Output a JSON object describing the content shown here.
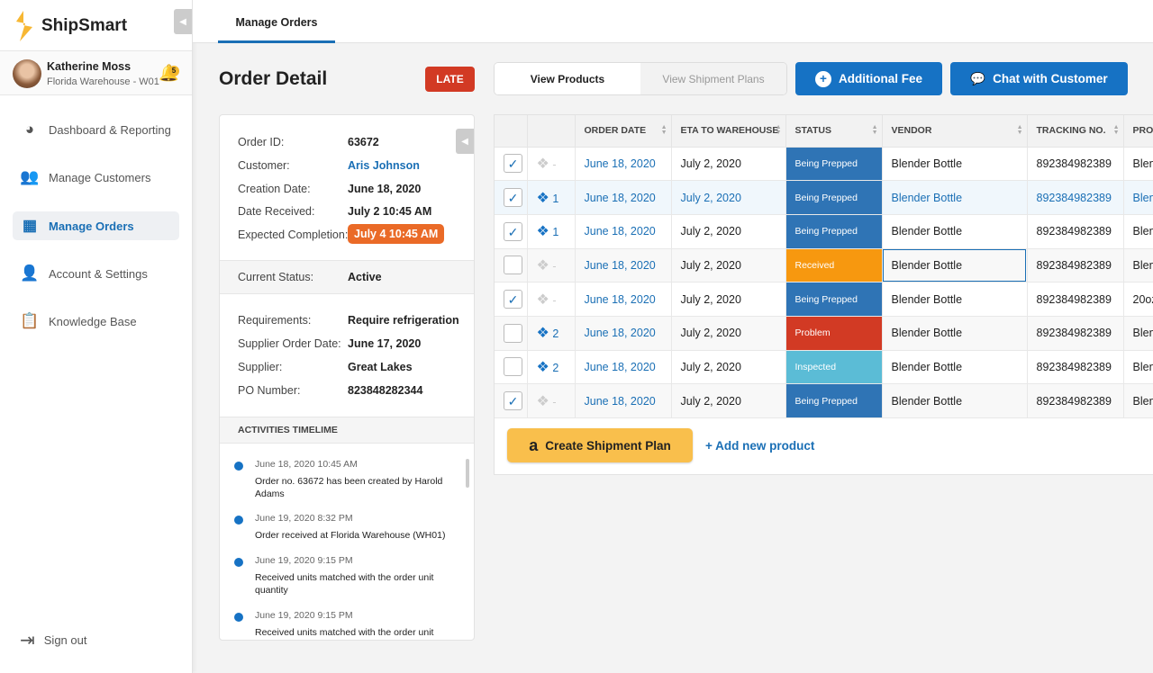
{
  "app": {
    "name": "ShipSmart"
  },
  "user": {
    "name": "Katherine Moss",
    "location": "Florida Warehouse - W01",
    "notifications": "5"
  },
  "nav": [
    {
      "label": "Dashboard & Reporting",
      "icon": "pie-chart-icon"
    },
    {
      "label": "Manage Customers",
      "icon": "users-icon"
    },
    {
      "label": "Manage Orders",
      "icon": "orders-grid-icon",
      "active": true
    },
    {
      "label": "Account & Settings",
      "icon": "user-icon"
    },
    {
      "label": "Knowledge Base",
      "icon": "clipboard-help-icon"
    }
  ],
  "signout": "Sign out",
  "topbar": {
    "tab": "Manage Orders"
  },
  "page": {
    "title": "Order Detail",
    "late": "LATE"
  },
  "views": {
    "products": "View Products",
    "plans": "View Shipment Plans"
  },
  "buttons": {
    "fee": "Additional Fee",
    "chat": "Chat with Customer",
    "plan": "Create Shipment Plan",
    "add": "+ Add new product"
  },
  "order": {
    "fields": [
      {
        "label": "Order ID:",
        "value": "63672"
      },
      {
        "label": "Customer:",
        "value": "Aris Johnson"
      },
      {
        "label": "Creation Date:",
        "value": "June 18, 2020"
      },
      {
        "label": "Date Received:",
        "value": "July 2 10:45 AM"
      },
      {
        "label": "Expected Completion:",
        "value": "July 4 10:45 AM"
      }
    ],
    "status": {
      "label": "Current Status:",
      "value": "Active"
    },
    "details": [
      {
        "label": "Requirements:",
        "value": "Require refrigeration"
      },
      {
        "label": "Supplier Order Date:",
        "value": "June 17, 2020"
      },
      {
        "label": "Supplier:",
        "value": "Great Lakes"
      },
      {
        "label": "PO Number:",
        "value": "823848282344"
      }
    ]
  },
  "timeline": {
    "title": "ACTIVITIES TIMELIME",
    "items": [
      {
        "date": "June 18, 2020 10:45 AM",
        "text": "Order no. 63672 has been created by Harold Adams"
      },
      {
        "date": "June 19, 2020 8:32 PM",
        "text": "Order received at Florida Warehouse (WH01)"
      },
      {
        "date": "June 19, 2020 9:15 PM",
        "text": "Received units matched with the order unit quantity"
      },
      {
        "date": "June 19, 2020 9:15 PM",
        "text": "Received units matched with the order unit"
      }
    ]
  },
  "table": {
    "columns": [
      "",
      "",
      "ORDER DATE",
      "ETA TO WAREHOUSE",
      "STATUS",
      "VENDOR",
      "TRACKING NO.",
      "PRODUCT"
    ],
    "status_colors": {
      "Being Prepped": "#2f74b5",
      "Received": "#f7980f",
      "Problem": "#d23a24",
      "Inspected": "#5bbcd6"
    },
    "rows": [
      {
        "checked": true,
        "count": "-",
        "order_date": "June 18, 2020",
        "eta": "July 2, 2020",
        "status": "Being Prepped",
        "vendor": "Blender Bottle",
        "tracking": "892384982389",
        "product": "Blender Bottle"
      },
      {
        "checked": true,
        "count": "1",
        "order_date": "June 18, 2020",
        "eta": "July 2, 2020",
        "status": "Being Prepped",
        "vendor": "Blender Bottle",
        "tracking": "892384982389",
        "product": "Blender Bottle"
      },
      {
        "checked": true,
        "count": "1",
        "order_date": "June 18, 2020",
        "eta": "July 2, 2020",
        "status": "Being Prepped",
        "vendor": "Blender Bottle",
        "tracking": "892384982389",
        "product": "Blender Bottle"
      },
      {
        "checked": false,
        "count": "-",
        "order_date": "June 18, 2020",
        "eta": "July 2, 2020",
        "status": "Received",
        "vendor": "Blender Bottle",
        "tracking": "892384982389",
        "product": "Blender Bottle"
      },
      {
        "checked": true,
        "count": "-",
        "order_date": "June 18, 2020",
        "eta": "July 2, 2020",
        "status": "Being Prepped",
        "vendor": "Blender Bottle",
        "tracking": "892384982389",
        "product": "20oz"
      },
      {
        "checked": false,
        "count": "2",
        "order_date": "June 18, 2020",
        "eta": "July 2, 2020",
        "status": "Problem",
        "vendor": "Blender Bottle",
        "tracking": "892384982389",
        "product": "Blender Bottle"
      },
      {
        "checked": false,
        "count": "2",
        "order_date": "June 18, 2020",
        "eta": "July 2, 2020",
        "status": "Inspected",
        "vendor": "Blender Bottle",
        "tracking": "892384982389",
        "product": "Blender Bottle"
      },
      {
        "checked": true,
        "count": "-",
        "order_date": "June 18, 2020",
        "eta": "July 2, 2020",
        "status": "Being Prepped",
        "vendor": "Blender Bottle",
        "tracking": "892384982389",
        "product": "Blender Bottle"
      }
    ]
  }
}
